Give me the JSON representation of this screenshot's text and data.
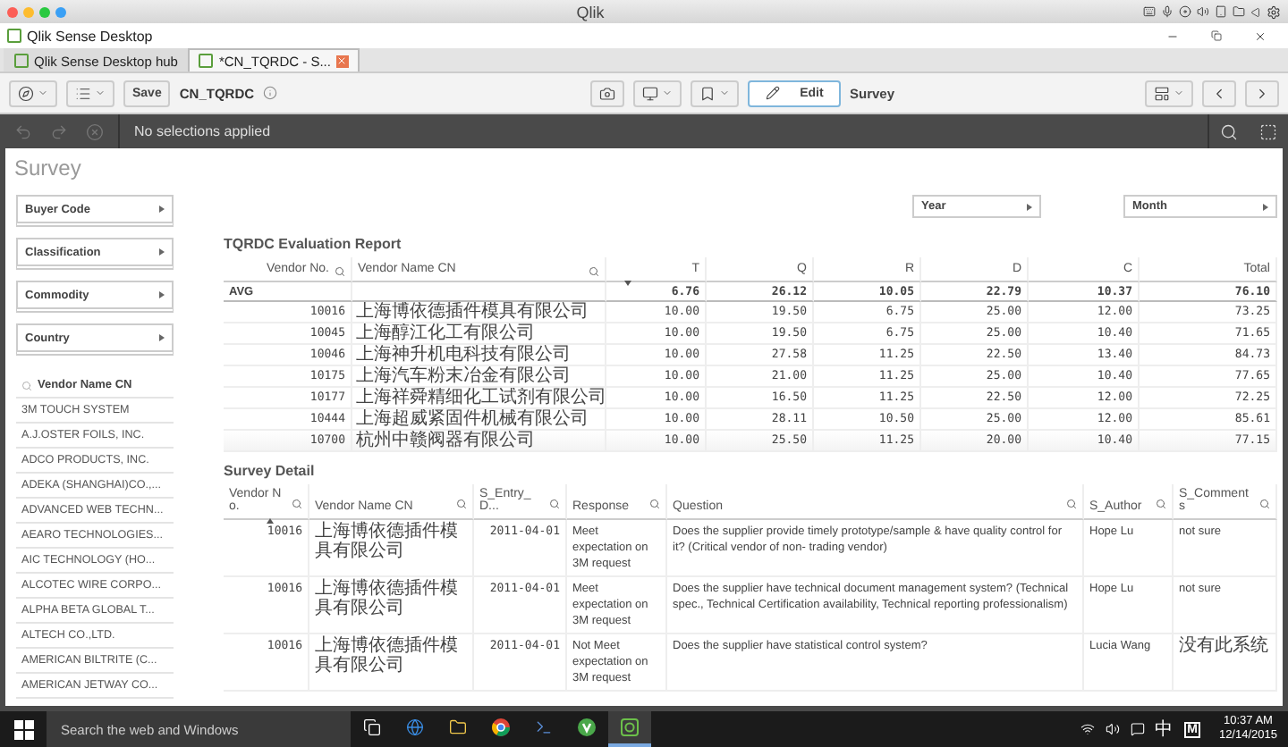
{
  "mac_title": "Qlik",
  "window": {
    "title": "Qlik Sense Desktop"
  },
  "browser_tabs": [
    {
      "label": "Qlik Sense Desktop hub",
      "selected": false
    },
    {
      "label": "*CN_TQRDC - S...",
      "selected": true
    }
  ],
  "toolbar": {
    "save": "Save",
    "app_name": "CN_TQRDC",
    "edit": {
      "label": "Edit",
      "active": true
    },
    "sheet": "Survey"
  },
  "selection_bar": {
    "text": "No selections applied"
  },
  "sheet_title": "Survey",
  "filters": [
    "Buyer Code",
    "Classification",
    "Commodity",
    "Country"
  ],
  "vendor_list": {
    "header": "Vendor Name CN",
    "items": [
      "3M TOUCH SYSTEM",
      "A.J.OSTER FOILS, INC.",
      "ADCO PRODUCTS, INC.",
      "ADEKA (SHANGHAI)CO.,...",
      "ADVANCED WEB TECHN...",
      "AEARO TECHNOLOGIES...",
      "AIC TECHNOLOGY (HO...",
      "ALCOTEC WIRE CORPO...",
      "ALPHA BETA GLOBAL T...",
      "ALTECH CO.,LTD.",
      "AMERICAN BILTRITE (C...",
      "AMERICAN JETWAY CO..."
    ]
  },
  "dropdowns": [
    "Year",
    "Month"
  ],
  "report": {
    "title": "TQRDC Evaluation Report",
    "columns": [
      {
        "label": "Vendor No.",
        "search": true,
        "sorted": false
      },
      {
        "label": "Vendor Name CN",
        "search": true,
        "sorted": false
      },
      {
        "label": "T",
        "search": false,
        "sorted": true
      },
      {
        "label": "Q",
        "search": false,
        "sorted": false
      },
      {
        "label": "R",
        "search": false,
        "sorted": false
      },
      {
        "label": "D",
        "search": false,
        "sorted": false
      },
      {
        "label": "C",
        "search": false,
        "sorted": false
      },
      {
        "label": "Total",
        "search": false,
        "sorted": false
      }
    ],
    "avg": {
      "label": "AVG",
      "values": [
        "6.76",
        "26.12",
        "10.05",
        "22.79",
        "10.37",
        "76.10"
      ]
    },
    "rows": [
      {
        "vendor_no": "10016",
        "name": "上海博依德插件模具有限公司",
        "values": [
          "10.00",
          "19.50",
          "6.75",
          "25.00",
          "12.00",
          "73.25"
        ]
      },
      {
        "vendor_no": "10045",
        "name": "上海醇江化工有限公司",
        "values": [
          "10.00",
          "19.50",
          "6.75",
          "25.00",
          "10.40",
          "71.65"
        ]
      },
      {
        "vendor_no": "10046",
        "name": "上海神升机电科技有限公司",
        "values": [
          "10.00",
          "27.58",
          "11.25",
          "22.50",
          "13.40",
          "84.73"
        ]
      },
      {
        "vendor_no": "10175",
        "name": "上海汽车粉末冶金有限公司",
        "values": [
          "10.00",
          "21.00",
          "11.25",
          "25.00",
          "10.40",
          "77.65"
        ]
      },
      {
        "vendor_no": "10177",
        "name": "上海祥舜精细化工试剂有限公司",
        "values": [
          "10.00",
          "16.50",
          "11.25",
          "22.50",
          "12.00",
          "72.25"
        ]
      },
      {
        "vendor_no": "10444",
        "name": "上海超威紧固件机械有限公司",
        "values": [
          "10.00",
          "28.11",
          "10.50",
          "25.00",
          "12.00",
          "85.61"
        ]
      },
      {
        "vendor_no": "10700",
        "name": "杭州中赣阀器有限公司",
        "values": [
          "10.00",
          "25.50",
          "11.25",
          "20.00",
          "10.40",
          "77.15"
        ]
      }
    ]
  },
  "detail": {
    "title": "Survey Detail",
    "columns": [
      {
        "label": "Vendor No.",
        "sorted": true
      },
      {
        "label": "Vendor Name CN",
        "sorted": false
      },
      {
        "label": "S_Entry_D...",
        "sorted": false
      },
      {
        "label": "Response",
        "sorted": false
      },
      {
        "label": "Question",
        "sorted": false
      },
      {
        "label": "S_Author",
        "sorted": false
      },
      {
        "label": "S_Comments",
        "sorted": false
      }
    ],
    "rows": [
      [
        "10016",
        "上海博依德插件模具有限公司",
        "2011-04-01",
        "Meet expectation on 3M request",
        "Does the supplier provide timely prototype/sample & have quality control for it? (Critical vendor of non- trading vendor)",
        "Hope Lu",
        "not sure"
      ],
      [
        "10016",
        "上海博依德插件模具有限公司",
        "2011-04-01",
        "Meet expectation on 3M request",
        "Does the supplier have technical document management system? (Technical spec., Technical Certification availability, Technical reporting professionalism)",
        "Hope Lu",
        "not sure"
      ],
      [
        "10016",
        "上海博依德插件模具有限公司",
        "2011-04-01",
        "Not Meet expectation on 3M request",
        "Does the supplier have statistical control system?",
        "Lucia Wang",
        "没有此系统"
      ]
    ]
  },
  "taskbar": {
    "placeholder": "Search the web and Windows",
    "apps": [
      {
        "kind": "task-view",
        "active": false
      },
      {
        "kind": "edge",
        "active": false
      },
      {
        "kind": "folder",
        "active": false
      },
      {
        "kind": "chrome",
        "active": false
      },
      {
        "kind": "shell",
        "active": false
      },
      {
        "kind": "qlikview",
        "active": false
      },
      {
        "kind": "qliksense",
        "active": true
      }
    ],
    "tray_text": [
      "中",
      "M"
    ],
    "time": "10:37 AM",
    "date": "12/14/2015"
  }
}
